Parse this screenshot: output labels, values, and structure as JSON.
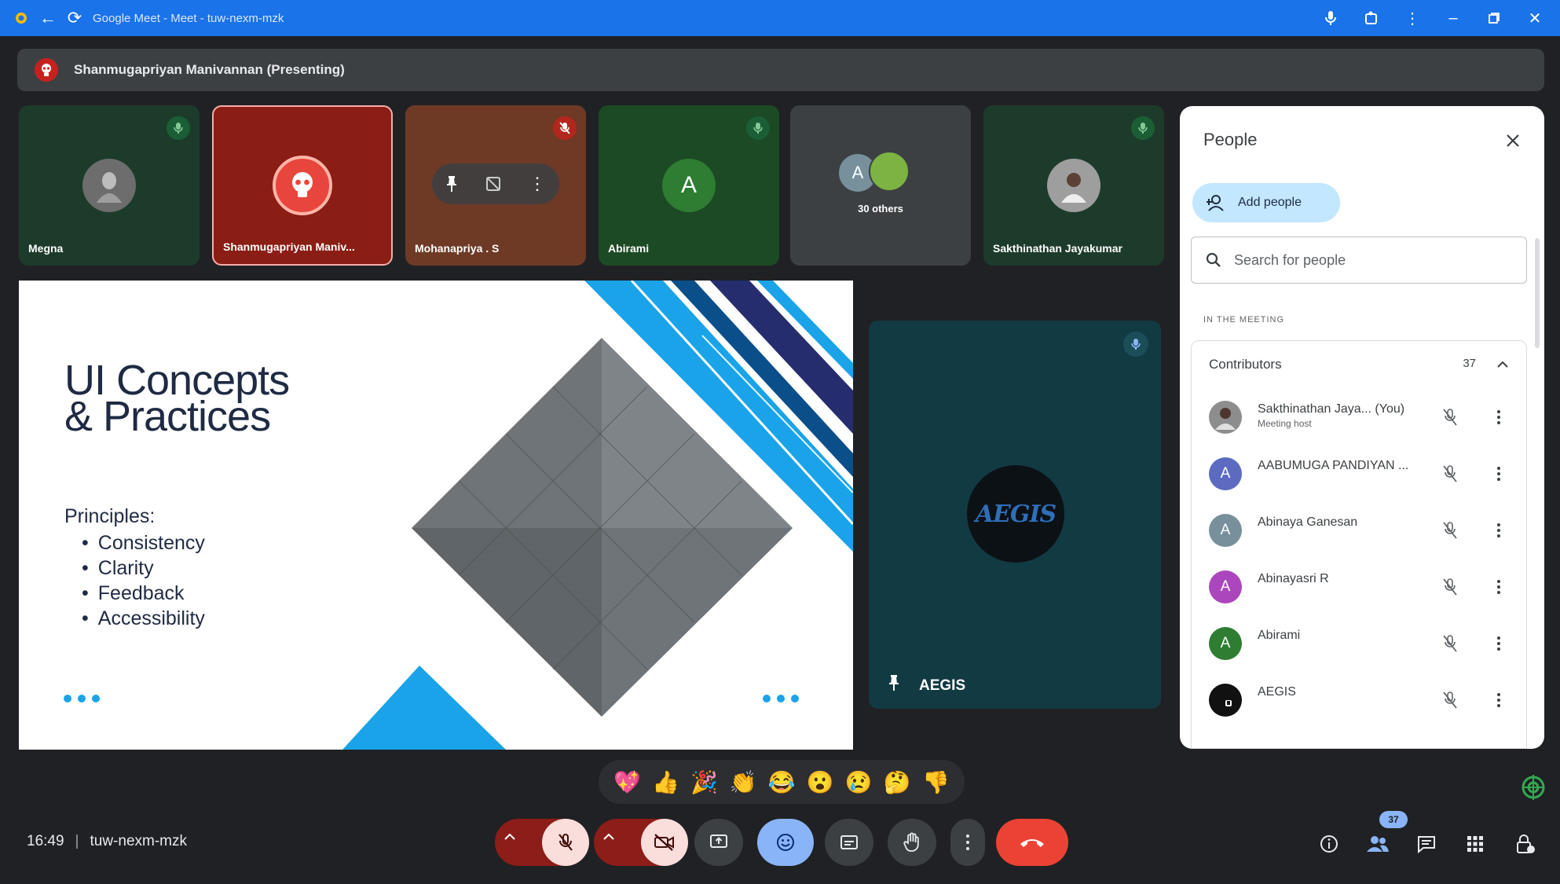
{
  "window": {
    "title": "Google Meet - Meet - tuw-nexm-mzk"
  },
  "banner": {
    "text": "Shanmugapriyan Manivannan (Presenting)"
  },
  "tiles": [
    {
      "name": "Megna",
      "bg": "#1d3b2b"
    },
    {
      "name": "Shanmugapriyan Maniv...",
      "bg": "#8a1d14"
    },
    {
      "name": "Mohanapriya . S",
      "bg": "#6e3a26"
    },
    {
      "name": "Abirami",
      "avatar_letter": "A",
      "bg": "#1c4a24"
    },
    {
      "name": "30 others",
      "avatar_letter": "A",
      "bg": "#3c4043"
    },
    {
      "name": "Sakthinathan Jayakumar",
      "bg": "#1d3b2b"
    }
  ],
  "slide": {
    "title_line1": "UI Concepts",
    "title_line2": "& Practices",
    "principles_label": "Principles:",
    "principles": [
      "Consistency",
      "Clarity",
      "Feedback",
      "Accessibility"
    ]
  },
  "aegis": {
    "name": "AEGIS",
    "logo_text": "AEGIS"
  },
  "people_panel": {
    "title": "People",
    "add_label": "Add people",
    "search_placeholder": "Search for people",
    "section_label": "IN THE MEETING",
    "group": {
      "label": "Contributors",
      "count": "37"
    },
    "participants": [
      {
        "name": "Sakthinathan Jaya... (You)",
        "sub": "Meeting host",
        "letter": "",
        "color": "#8d8d8d"
      },
      {
        "name": "AABUMUGA PANDIYAN ...",
        "sub": "",
        "letter": "A",
        "color": "#5c6bc0"
      },
      {
        "name": "Abinaya Ganesan",
        "sub": "",
        "letter": "A",
        "color": "#78909c"
      },
      {
        "name": "Abinayasri R",
        "sub": "",
        "letter": "A",
        "color": "#ab47bc"
      },
      {
        "name": "Abirami",
        "sub": "",
        "letter": "A",
        "color": "#2e7d32"
      },
      {
        "name": "AEGIS",
        "sub": "",
        "letter": "",
        "color": "#111111"
      }
    ]
  },
  "reactions": [
    "💖",
    "👍",
    "🎉",
    "👏",
    "😂",
    "😮",
    "😢",
    "🤔",
    "👎"
  ],
  "meeting": {
    "time": "16:49",
    "code": "tuw-nexm-mzk",
    "people_count": "37"
  },
  "colors": {
    "accent": "#1a73e8",
    "end_call": "#ea4335",
    "muted_btn": "#f9dedc",
    "reaction_active": "#8ab4f8"
  }
}
